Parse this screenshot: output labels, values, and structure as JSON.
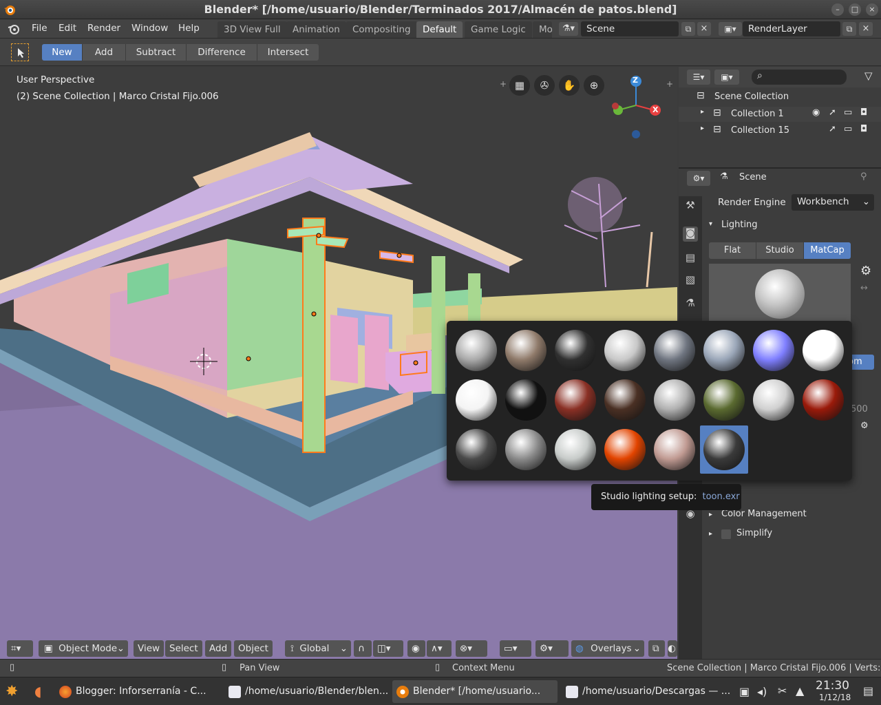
{
  "window": {
    "title": "Blender* [/home/usuario/Blender/Terminados 2017/Almacén de patos.blend]"
  },
  "menubar": {
    "items": [
      "File",
      "Edit",
      "Render",
      "Window",
      "Help"
    ],
    "workspaces": [
      "3D View Full",
      "Animation",
      "Compositing",
      "Default",
      "Game Logic",
      "Mo"
    ],
    "active_workspace": "Default",
    "scene": "Scene",
    "render_layer": "RenderLayer"
  },
  "toolheader": {
    "mode_buttons": [
      "New",
      "Add",
      "Subtract",
      "Difference",
      "Intersect"
    ],
    "active": "New"
  },
  "viewport": {
    "perspective": "User Perspective",
    "context": "(2) Scene Collection | Marco Cristal Fijo.006",
    "gizmo": {
      "z": "Z",
      "x": "X"
    },
    "footer": {
      "mode": "Object Mode",
      "menus": [
        "View",
        "Select",
        "Add",
        "Object"
      ],
      "orientation": "Global",
      "overlays": "Overlays"
    }
  },
  "outliner": {
    "root": "Scene Collection",
    "collections": [
      "Collection 1",
      "Collection 15"
    ]
  },
  "properties": {
    "context": "Scene",
    "render_engine_label": "Render Engine",
    "render_engine": "Workbench",
    "lighting_panel": "Lighting",
    "lighting_modes": [
      "Flat",
      "Studio",
      "MatCap"
    ],
    "lighting_active": "MatCap",
    "color_management": "Color Management",
    "simplify": "Simplify",
    "partial_texts": {
      "om": "om",
      "500a": "500",
      "500b": "500"
    }
  },
  "matcap_popup": {
    "spheres": [
      {
        "name": "basic-1",
        "color": "#a9a9a9"
      },
      {
        "name": "basic-2",
        "color": "#8f7a6a"
      },
      {
        "name": "basic-dark",
        "color": "#303030"
      },
      {
        "name": "basic-side",
        "color": "#c8c8c8"
      },
      {
        "name": "ceramic-dark",
        "color": "#6f7580"
      },
      {
        "name": "ceramic-lightbulb",
        "color": "#9aa6b8"
      },
      {
        "name": "check-normal-y",
        "color": "#7f7fff"
      },
      {
        "name": "check-rim-dark",
        "color": "#ffffff"
      },
      {
        "name": "clay-studio",
        "color": "#f4f4f4"
      },
      {
        "name": "jade",
        "color": "#111111"
      },
      {
        "name": "metal-carpaint",
        "color": "#8a3025"
      },
      {
        "name": "metal-anisotropic",
        "color": "#4a3024"
      },
      {
        "name": "metal-lead",
        "color": "#b0b0b0"
      },
      {
        "name": "pearl",
        "color": "#5a6a30"
      },
      {
        "name": "reflection-check",
        "color": "#d0d0d0"
      },
      {
        "name": "resin",
        "color": "#9a1a0a"
      },
      {
        "name": "skin",
        "color": "#4a4a4a"
      },
      {
        "name": "toon-ball",
        "color": "#8a8a8a"
      },
      {
        "name": "studio-silver",
        "color": "#c7cbc9"
      },
      {
        "name": "orange",
        "color": "#e24400"
      },
      {
        "name": "clay-brown",
        "color": "#c09a92"
      },
      {
        "name": "toon",
        "color": "#3a3a3a"
      }
    ],
    "selected_index": 21
  },
  "tooltip": {
    "label": "Studio lighting setup:",
    "value": "toon.exr"
  },
  "statusbar": {
    "pan": "Pan View",
    "context_menu": "Context Menu",
    "stats": "Scene Collection | Marco Cristal Fijo.006 | Verts:1,"
  },
  "taskbar": {
    "tasks": [
      "Blogger: Inforserranía - C...",
      "/home/usuario/Blender/blen...",
      "Blender* [/home/usuario...",
      "/home/usuario/Descargas — ..."
    ],
    "time": "21:30",
    "date": "1/12/18"
  },
  "colors": {
    "accent": "#5680c2",
    "panel": "#3d3d3d",
    "selected_outline": "#ff7a1a"
  }
}
